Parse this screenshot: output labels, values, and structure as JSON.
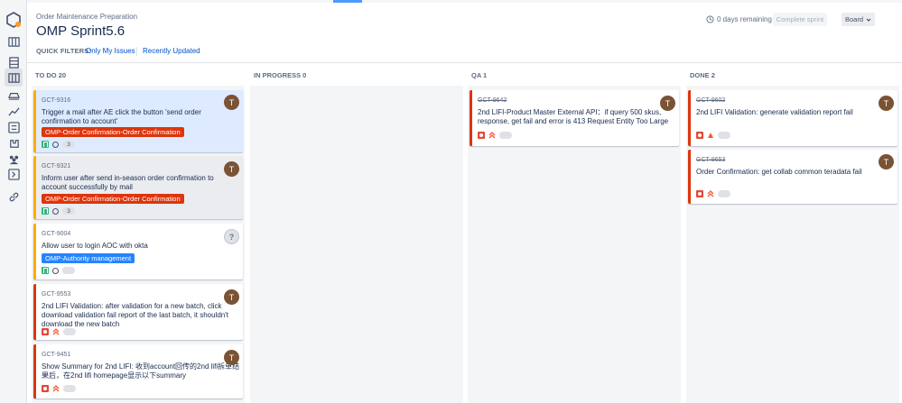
{
  "header": {
    "breadcrumb": "Order Maintenance Preparation",
    "title": "OMP Sprint5.6",
    "quick_filters_label": "QUICK FILTERS:",
    "quick_filters": [
      "Only My Issues",
      "Recently Updated"
    ],
    "days_remaining": "0 days remaining",
    "complete_sprint": "Complete sprint",
    "board_button": "Board"
  },
  "columns": [
    {
      "title": "TO DO 20"
    },
    {
      "title": "IN PROGRESS 0"
    },
    {
      "title": "QA 1"
    },
    {
      "title": "DONE 2"
    }
  ],
  "todo_cards": [
    {
      "key": "GCT-9316",
      "summary_lines": [
        "Trigger a mail after AE click the button 'send order",
        "confirmation to account'"
      ],
      "epic": "OMP-Order Confirmation-Order Confirmation",
      "avatar": "T",
      "count": "3"
    },
    {
      "key": "GCT-9321",
      "summary_lines": [
        "Inform user after send in-season order confirmation to",
        "account successfully by mail"
      ],
      "epic": "OMP-Order Confirmation-Order Confirmation",
      "avatar": "T",
      "count": "3"
    },
    {
      "key": "GCT-9004",
      "summary_lines": [
        "Allow user to login AOC with okta"
      ],
      "epic": "OMP-Authority management",
      "avatar": "?"
    },
    {
      "key": "GCT-9553",
      "summary_lines": [
        "2nd LIFI Validation: after validation for a new batch, click",
        "download validation fail report of the last batch, it shouldn't",
        "download the new batch"
      ],
      "avatar": "T"
    },
    {
      "key": "GCT-9451",
      "summary_lines": [
        "Show Summary for 2nd LIFI: 收到account回传的2nd lifi拆单结",
        "果后，在2nd lifi homepage显示以下summary"
      ],
      "avatar": "T"
    }
  ],
  "qa_cards": [
    {
      "key": "GCT-9642",
      "summary_lines": [
        "2nd LIFI-Product Master External API：if query 500 skus,",
        "response, get fail and error is 413 Request Entity Too Large"
      ],
      "avatar": "T"
    }
  ],
  "done_cards": [
    {
      "key": "GCT-9602",
      "summary_lines": [
        "2nd LIFI Validation: generate validation report fail"
      ],
      "avatar": "T"
    },
    {
      "key": "GCT-9653",
      "summary_lines": [
        "Order Confirmation: get collab common teradata fail"
      ],
      "avatar": "T"
    }
  ]
}
